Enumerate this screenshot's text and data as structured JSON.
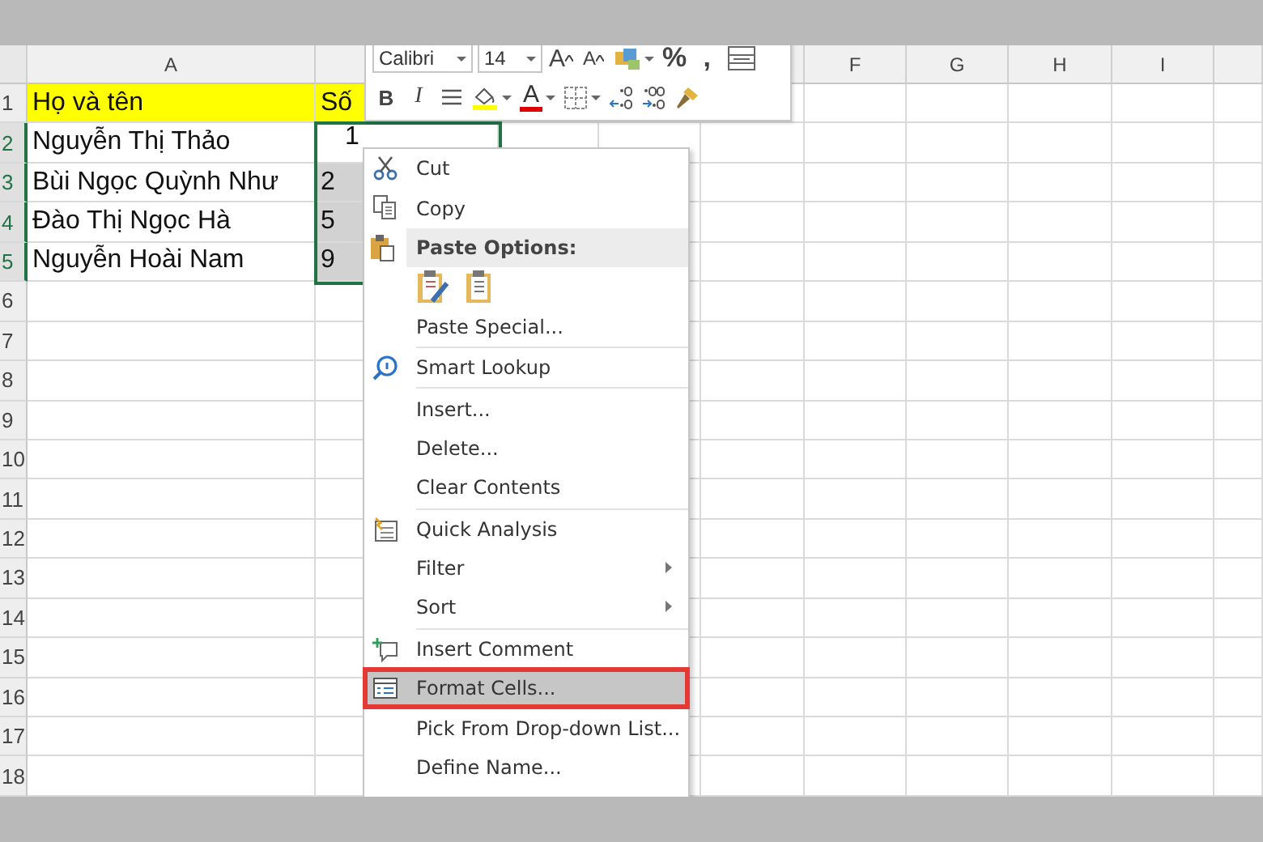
{
  "columns": [
    {
      "label": "A"
    },
    {
      "label": "F"
    },
    {
      "label": "G"
    },
    {
      "label": "H"
    },
    {
      "label": "I"
    }
  ],
  "rows": [
    {
      "number": "1",
      "selected": false,
      "highlighted": true,
      "cells": [
        {
          "text": "Họ và tên",
          "selected": false
        },
        {
          "text": "Số",
          "selected": false
        }
      ]
    },
    {
      "number": "2",
      "selected": true,
      "highlighted": false,
      "cells": [
        {
          "text": "Nguyễn Thị Thảo",
          "selected": false
        },
        {
          "text": "1",
          "selected": false
        }
      ]
    },
    {
      "number": "3",
      "selected": true,
      "highlighted": false,
      "cells": [
        {
          "text": "Bùi Ngọc Quỳnh Như",
          "selected": false
        },
        {
          "text": "2",
          "selected": true
        }
      ]
    },
    {
      "number": "4",
      "selected": true,
      "highlighted": false,
      "cells": [
        {
          "text": "Đào Thị Ngọc Hà",
          "selected": false
        },
        {
          "text": "5",
          "selected": true
        }
      ]
    },
    {
      "number": "5",
      "selected": true,
      "highlighted": false,
      "cells": [
        {
          "text": "Nguyễn Hoài Nam",
          "selected": false
        },
        {
          "text": "9",
          "selected": true
        }
      ]
    },
    {
      "number": "6",
      "selected": false,
      "highlighted": false
    },
    {
      "number": "7",
      "selected": false,
      "highlighted": false
    },
    {
      "number": "8",
      "selected": false,
      "highlighted": false
    },
    {
      "number": "9",
      "selected": false,
      "highlighted": false
    },
    {
      "number": "10",
      "selected": false,
      "highlighted": false
    },
    {
      "number": "11",
      "selected": false,
      "highlighted": false
    },
    {
      "number": "12",
      "selected": false,
      "highlighted": false
    },
    {
      "number": "13",
      "selected": false,
      "highlighted": false
    },
    {
      "number": "14",
      "selected": false,
      "highlighted": false
    },
    {
      "number": "15",
      "selected": false,
      "highlighted": false
    },
    {
      "number": "16",
      "selected": false,
      "highlighted": false
    },
    {
      "number": "17",
      "selected": false,
      "highlighted": false
    },
    {
      "number": "18",
      "selected": false,
      "highlighted": false
    }
  ],
  "mini_toolbar": {
    "row_1": [
      {
        "kind": "font-box",
        "value": "Calibri"
      },
      {
        "kind": "size-box",
        "value": "14"
      },
      {
        "kind": "grow",
        "label": "A"
      },
      {
        "kind": "shrink",
        "label": "A"
      },
      {
        "kind": "styles"
      },
      {
        "kind": "text",
        "label": "%"
      },
      {
        "kind": "text",
        "label": ","
      },
      {
        "kind": "wrap"
      }
    ],
    "row_2": [
      {
        "kind": "bold",
        "label": "B"
      },
      {
        "kind": "italic",
        "label": "I"
      },
      {
        "kind": "align"
      },
      {
        "kind": "fill-color"
      },
      {
        "kind": "font-color",
        "label": "A"
      },
      {
        "kind": "borders"
      },
      {
        "kind": "increase-decimal"
      },
      {
        "kind": "decrease-decimal"
      },
      {
        "kind": "painter"
      }
    ]
  },
  "context_menu": [
    {
      "kind": "item",
      "label": "Cut",
      "selected": false,
      "submenu": false,
      "annotated": false
    },
    {
      "kind": "item",
      "label": "Copy",
      "selected": false,
      "submenu": false,
      "annotated": false
    },
    {
      "kind": "header",
      "label": "Paste Options:"
    },
    {
      "kind": "paste-options"
    },
    {
      "kind": "item",
      "label": "Paste Special...",
      "selected": false,
      "submenu": false,
      "annotated": false
    },
    {
      "kind": "separator"
    },
    {
      "kind": "item",
      "label": "Smart Lookup",
      "selected": false,
      "submenu": false,
      "annotated": false
    },
    {
      "kind": "separator"
    },
    {
      "kind": "item",
      "label": "Insert...",
      "selected": false,
      "submenu": false,
      "annotated": false
    },
    {
      "kind": "item",
      "label": "Delete...",
      "selected": false,
      "submenu": false,
      "annotated": false
    },
    {
      "kind": "item",
      "label": "Clear Contents",
      "selected": false,
      "submenu": false,
      "annotated": false
    },
    {
      "kind": "separator"
    },
    {
      "kind": "item",
      "label": "Quick Analysis",
      "selected": false,
      "submenu": false,
      "annotated": false
    },
    {
      "kind": "item",
      "label": "Filter",
      "selected": false,
      "submenu": true,
      "annotated": false
    },
    {
      "kind": "item",
      "label": "Sort",
      "selected": false,
      "submenu": true,
      "annotated": false
    },
    {
      "kind": "separator"
    },
    {
      "kind": "item",
      "label": "Insert Comment",
      "selected": false,
      "submenu": false,
      "annotated": false
    },
    {
      "kind": "item",
      "label": "Format Cells...",
      "selected": true,
      "submenu": false,
      "annotated": true
    },
    {
      "kind": "item",
      "label": "Pick From Drop-down List...",
      "selected": false,
      "submenu": false,
      "annotated": false
    },
    {
      "kind": "item",
      "label": "Define Name...",
      "selected": false,
      "submenu": false,
      "annotated": false
    }
  ]
}
